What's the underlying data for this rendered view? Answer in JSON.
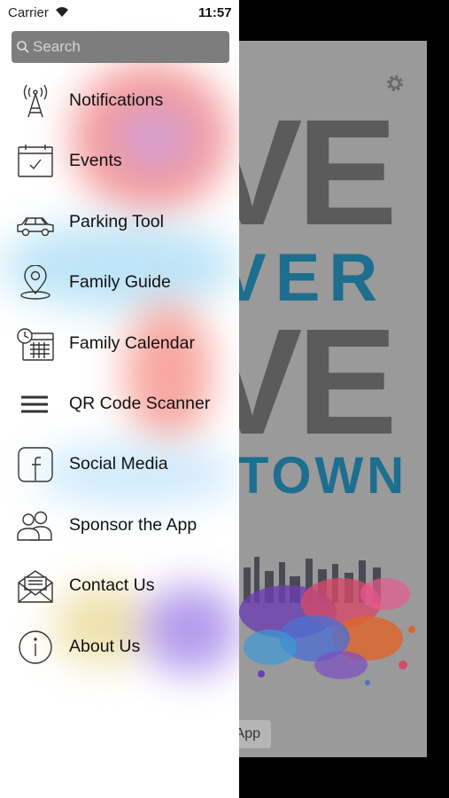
{
  "status_bar": {
    "carrier": "Carrier",
    "time": "11:57"
  },
  "search": {
    "placeholder": "Search"
  },
  "menu": {
    "items": [
      {
        "label": "Notifications",
        "icon": "antenna-icon"
      },
      {
        "label": "Events",
        "icon": "calendar-check-icon"
      },
      {
        "label": "Parking Tool",
        "icon": "car-icon"
      },
      {
        "label": "Family Guide",
        "icon": "map-pin-icon"
      },
      {
        "label": "Family Calendar",
        "icon": "calendar-clock-icon"
      },
      {
        "label": "QR Code Scanner",
        "icon": "hamburger-icon"
      },
      {
        "label": "Social Media",
        "icon": "facebook-icon"
      },
      {
        "label": "Sponsor the App",
        "icon": "users-icon"
      },
      {
        "label": "Contact Us",
        "icon": "envelope-icon"
      },
      {
        "label": "About Us",
        "icon": "info-icon"
      }
    ]
  },
  "background": {
    "line1": "VE",
    "line2": "VER",
    "line3": "VE",
    "line4": "TOWN",
    "button_fragment": "App"
  },
  "colors": {
    "accent_blue": "#1d6e8f",
    "drawer_bg": "#ffffff",
    "search_bg": "#7d7d7d"
  }
}
